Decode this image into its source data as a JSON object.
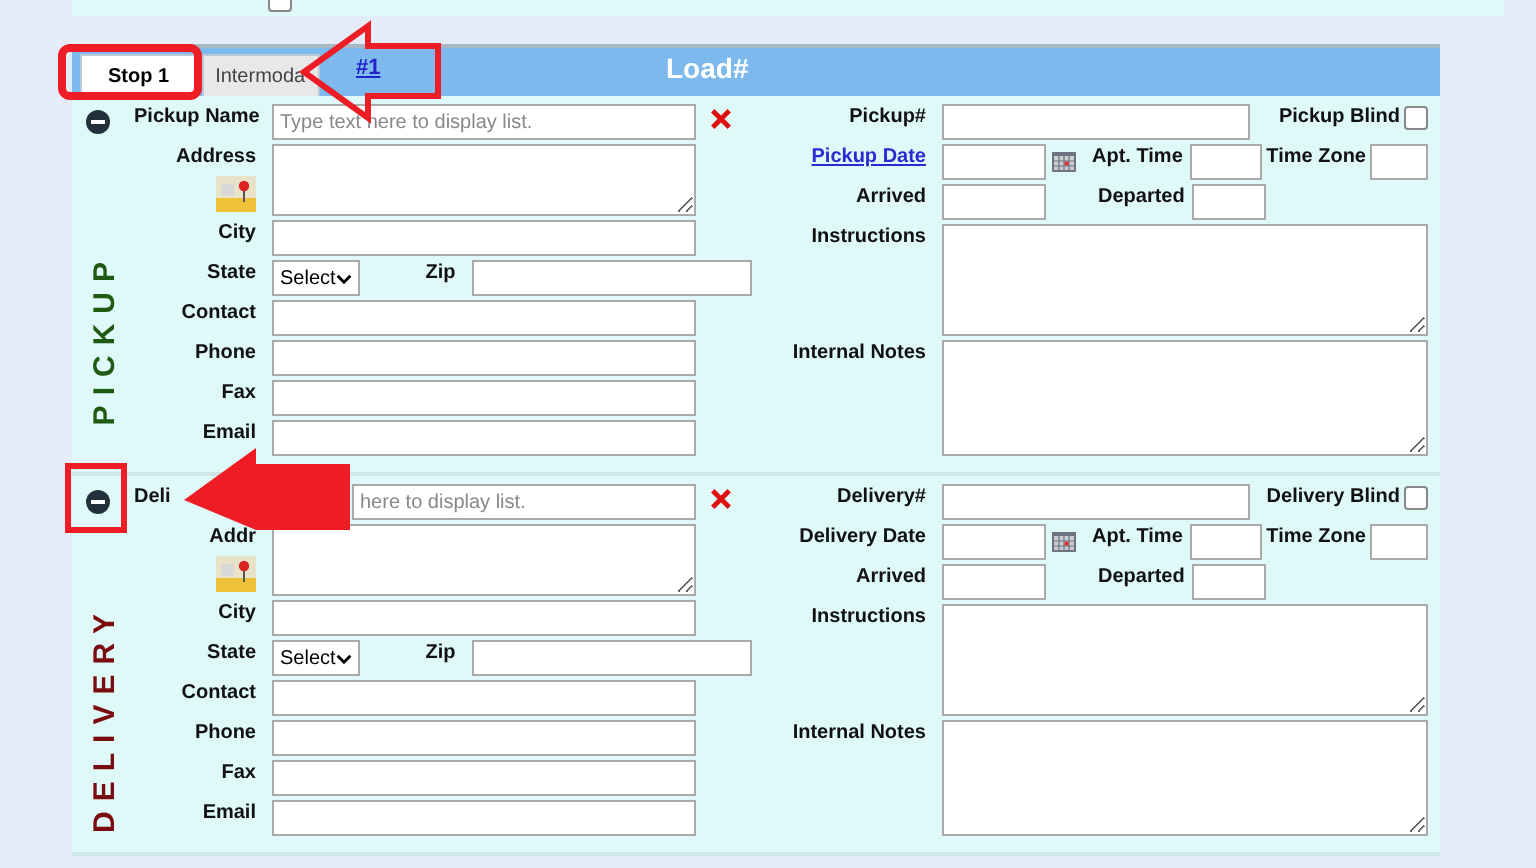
{
  "tabs": [
    {
      "label": "Stop 1",
      "selected": true
    },
    {
      "label": "Intermoda",
      "selected": false
    }
  ],
  "top_checkbox": {
    "checked": false
  },
  "stop_link": "#1",
  "load_label": "Load#",
  "sections": [
    {
      "kind": "pickup",
      "title": "PICKUP",
      "name_label": "Pickup Name",
      "name_placeholder": "Type text here to display list.",
      "address_label": "Address",
      "city_label": "City",
      "state_label": "State",
      "state_value": "Select",
      "zip_label": "Zip",
      "contact_label": "Contact",
      "phone_label": "Phone",
      "fax_label": "Fax",
      "email_label": "Email",
      "number_label": "Pickup#",
      "blind_label": "Pickup Blind",
      "blind_checked": false,
      "date_label": "Pickup Date",
      "date_is_link": true,
      "apt_label": "Apt. Time",
      "tz_label": "Time Zone",
      "arrived_label": "Arrived",
      "departed_label": "Departed",
      "instructions_label": "Instructions",
      "notes_label": "Internal Notes"
    },
    {
      "kind": "delivery",
      "title": "DELIVERY",
      "name_label": "Deli",
      "name_placeholder": "here to display list.",
      "address_label": "Addr",
      "city_label": "City",
      "state_label": "State",
      "state_value": "Select",
      "zip_label": "Zip",
      "contact_label": "Contact",
      "phone_label": "Phone",
      "fax_label": "Fax",
      "email_label": "Email",
      "number_label": "Delivery#",
      "blind_label": "Delivery Blind",
      "blind_checked": false,
      "date_label": "Delivery Date",
      "date_is_link": false,
      "apt_label": "Apt. Time",
      "tz_label": "Time Zone",
      "arrived_label": "Arrived",
      "departed_label": "Departed",
      "instructions_label": "Instructions",
      "notes_label": "Internal Notes"
    }
  ]
}
